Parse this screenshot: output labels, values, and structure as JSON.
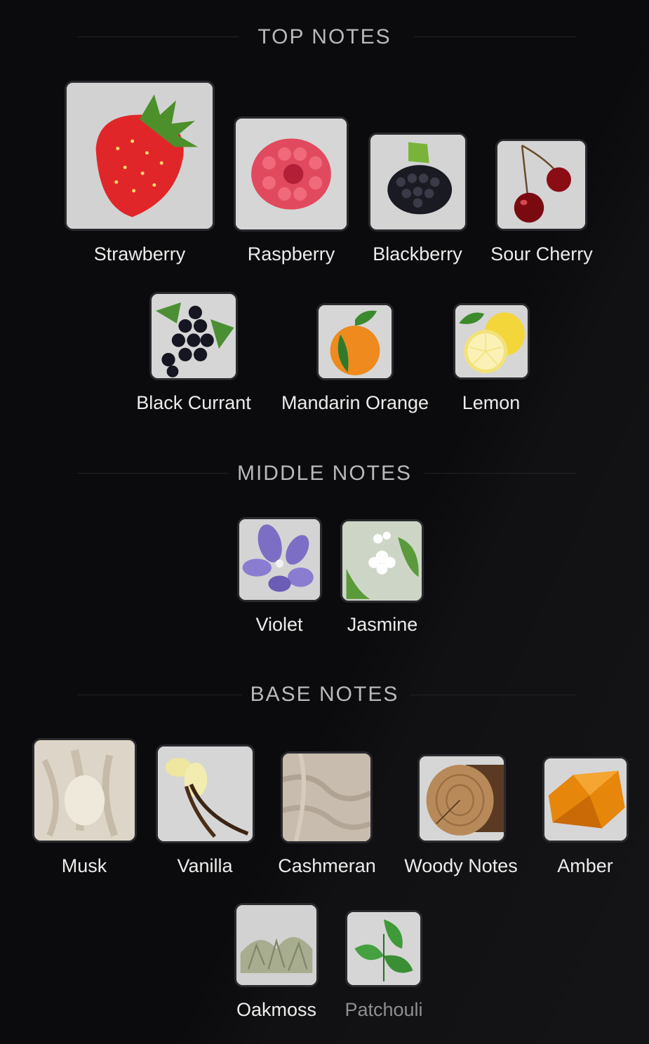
{
  "sections": {
    "top": {
      "title": "TOP NOTES",
      "notes": [
        {
          "label": "Strawberry",
          "icon": "strawberry-icon"
        },
        {
          "label": "Raspberry",
          "icon": "raspberry-icon"
        },
        {
          "label": "Blackberry",
          "icon": "blackberry-icon"
        },
        {
          "label": "Sour Cherry",
          "icon": "sour-cherry-icon"
        },
        {
          "label": "Black Currant",
          "icon": "black-currant-icon"
        },
        {
          "label": "Mandarin Orange",
          "icon": "mandarin-orange-icon"
        },
        {
          "label": "Lemon",
          "icon": "lemon-icon"
        }
      ]
    },
    "middle": {
      "title": "MIDDLE NOTES",
      "notes": [
        {
          "label": "Violet",
          "icon": "violet-icon"
        },
        {
          "label": "Jasmine",
          "icon": "jasmine-icon"
        }
      ]
    },
    "base": {
      "title": "BASE NOTES",
      "notes": [
        {
          "label": "Musk",
          "icon": "musk-icon"
        },
        {
          "label": "Vanilla",
          "icon": "vanilla-icon"
        },
        {
          "label": "Cashmeran",
          "icon": "cashmeran-icon"
        },
        {
          "label": "Woody Notes",
          "icon": "woody-notes-icon"
        },
        {
          "label": "Amber",
          "icon": "amber-icon"
        },
        {
          "label": "Oakmoss",
          "icon": "oakmoss-icon"
        },
        {
          "label": "Patchouli",
          "icon": "patchouli-icon"
        }
      ]
    }
  },
  "colors": {
    "background": "#0b0b0d",
    "heading": "#b9b9bd",
    "label": "#ececec",
    "label_dim": "#8e8e93"
  }
}
